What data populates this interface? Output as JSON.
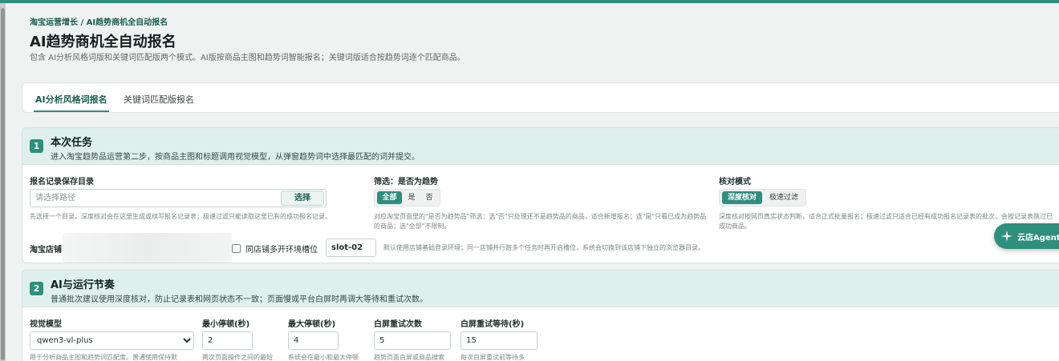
{
  "breadcrumb": "淘宝运营增长 / AI趋势商机全自动报名",
  "page_title": "AI趋势商机全自动报名",
  "page_desc": "包含 AI分析风格词版和关键词匹配版两个模式。AI版按商品主图和趋势词智能报名；关键词版适合按趋势词逐个匹配商品。",
  "tabs": [
    {
      "label": "AI分析风格词报名",
      "active": true
    },
    {
      "label": "关键词匹配版报名",
      "active": false
    }
  ],
  "section1": {
    "number": "1",
    "title": "本次任务",
    "subtitle": "进入淘宝趋势品运营第二步，按商品主图和标题调用视觉模型，从弹窗趋势词中选择最匹配的词并提交。",
    "save_dir": {
      "label": "报名记录保存目录",
      "placeholder": "请选择路径",
      "button": "选择",
      "hint": "先选择一个目录。深度核对会在这里生成或续写报名记录表；极速过滤只能读取这里已有的成功报名记录。"
    },
    "filter": {
      "label": "筛选：是否为趋势",
      "options": [
        "全部",
        "是",
        "否"
      ],
      "selected": "全部",
      "hint": "对应淘宝页面里的\"是否为趋势品\"筛选：选\"否\"只处理还不是趋势品的商品，适合新增报名；选\"是\"只看已成为趋势品的商品；选\"全部\"不限制。"
    },
    "check_mode": {
      "label": "核对模式",
      "options": [
        "深度核对",
        "极速过滤"
      ],
      "selected": "深度核对",
      "hint": "深度核对按网页真实状态判断，适合正式批量报名；极速过滤只适合已经有成功报名记录表的批次，会按记录表跳过已成功商品。"
    },
    "shop": {
      "label": "淘宝店铺",
      "multi_env_label": "同店铺多开环境槽位",
      "slot_value": "slot-02",
      "hint": "默认使用店铺基础登录环境；同一店铺并行跑多个任务时再开启槽位，系统会切换到该店铺下独立的浏览器目录。"
    }
  },
  "section2": {
    "number": "2",
    "title": "AI与运行节奏",
    "subtitle": "普通批次建议使用深度核对，防止记录表和网页状态不一致；页面慢或平台白屏时再调大等待和重试次数。",
    "fields": {
      "model": {
        "label": "视觉模型",
        "value": "qwen3-vl-plus",
        "hint": "用于分析商品主图和趋势词匹配度。普通使用保持默"
      },
      "min_pause": {
        "label": "最小停顿(秒)",
        "value": "2",
        "hint": "两次页面操作之间的最短"
      },
      "max_pause": {
        "label": "最大停顿(秒)",
        "value": "4",
        "hint": "系统会在最小和最大停顿"
      },
      "blank_retry": {
        "label": "白屏重试次数",
        "value": "5",
        "hint": "趋势页面白屏或商品搜索"
      },
      "blank_wait": {
        "label": "白屏重试等待(秒)",
        "value": "15",
        "hint": "每次白屏重试前等待多"
      }
    }
  },
  "agent_button": {
    "label": "云店Agent",
    "icon": "sparkle-icon"
  },
  "colors": {
    "accent": "#2f8f7d",
    "header_bg": "#dff0ec",
    "page_bg": "#eef2f1"
  }
}
